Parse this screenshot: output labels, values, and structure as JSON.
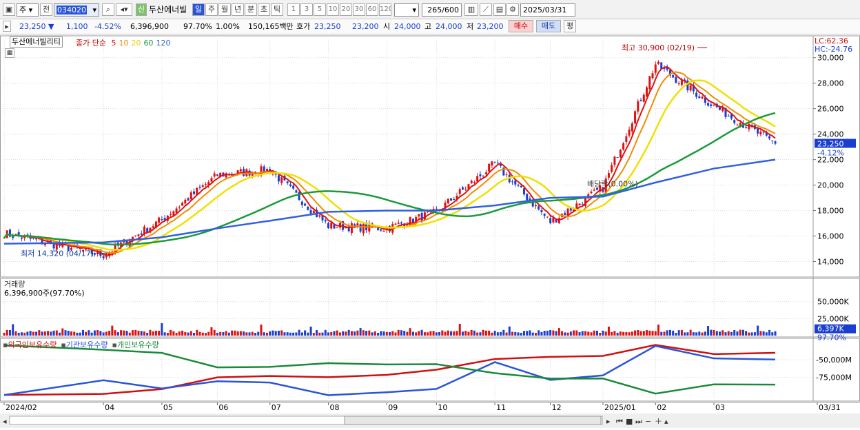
{
  "toolbar": {
    "mode": "주",
    "prev": "전",
    "code": "034020",
    "shin": "신",
    "stock_name": "두산에너빌",
    "periods": [
      "일",
      "주",
      "월",
      "년",
      "분",
      "초",
      "틱"
    ],
    "active_period": "일",
    "nums": [
      "1",
      "3",
      "5",
      "10",
      "20",
      "30",
      "60",
      "120"
    ],
    "count": "265",
    "count_total": "/600",
    "date": "2025/03/31"
  },
  "quote": {
    "price": "23,250",
    "arrow": "▼",
    "change": "1,100",
    "change_pct": "-4.52%",
    "volume": "6,396,900",
    "vol_ratio": "97.70%",
    "rate": "1.00%",
    "amount": "150,165백만",
    "ho_label": "호가",
    "ask": "23,250",
    "bid": "23,200",
    "open_label": "시",
    "open": "24,000",
    "high_label": "고",
    "high": "24,000",
    "low_label": "저",
    "low": "23,200",
    "buy_btn": "매수",
    "sell_btn": "매도",
    "eval_btn": "평"
  },
  "price_panel": {
    "name_tag": "두산에너빌리티",
    "ma_label": "종가 단순",
    "ma_periods": [
      {
        "period": "5",
        "color": "#e01010"
      },
      {
        "period": "10",
        "color": "#f08c00"
      },
      {
        "period": "20",
        "color": "#e8d000"
      },
      {
        "period": "60",
        "color": "#1a9a3a"
      },
      {
        "period": "120",
        "color": "#3060e0"
      }
    ],
    "lc": "LC:62.36",
    "hc": "HC:-24.76",
    "high_annot": "최고 30,900 (02/19)",
    "low_annot": "최저 14,320 (04/17)",
    "dividend_annot": "배당락(0.00%)",
    "price_tag": "23,250",
    "price_tag_pct": "-4.12%"
  },
  "volume_panel": {
    "title": "거래량",
    "value": "6,396,900주(97.70%)",
    "tag": "6,397K",
    "tag_pct": "97.70%"
  },
  "holders_panel": {
    "series": [
      {
        "name": "외국인보유수량",
        "color": "#d01010"
      },
      {
        "name": "기관보유수량",
        "color": "#2a55d8"
      },
      {
        "name": "개인보유수량",
        "color": "#1a8a3a"
      }
    ]
  },
  "x_axis": [
    "2024/02",
    "04",
    "05",
    "06",
    "07",
    "08",
    "09",
    "10",
    "11",
    "12",
    "2025/01",
    "02",
    "03",
    "03/31"
  ],
  "colors": {
    "up": "#e01010",
    "down": "#1a3fd0",
    "ma5": "#e01010",
    "ma10": "#f08c00",
    "ma20": "#f0e000",
    "ma60": "#1a9a3a",
    "ma120": "#3060e0"
  },
  "chart_data": [
    {
      "type": "line",
      "title": "두산에너빌리티 종가",
      "x": [
        "2024/02",
        "04",
        "05",
        "06",
        "07",
        "08",
        "09",
        "10",
        "11",
        "12",
        "2025/01",
        "02",
        "03",
        "03/31"
      ],
      "series": [
        {
          "name": "종가",
          "values": [
            16200,
            14500,
            17300,
            20800,
            21200,
            16800,
            16600,
            17900,
            21700,
            17100,
            19800,
            29500,
            26200,
            23250
          ]
        },
        {
          "name": "120",
          "values": [
            15400,
            15500,
            15900,
            16600,
            17200,
            17900,
            18000,
            18000,
            18400,
            19000,
            19100,
            20200,
            21300,
            22000
          ]
        }
      ],
      "ylim": [
        13000,
        31500
      ],
      "y_ticks": [
        "14,000",
        "16,000",
        "18,000",
        "20,000",
        "22,000",
        "24,000",
        "26,000",
        "28,000",
        "30,000"
      ]
    },
    {
      "type": "bar",
      "title": "거래량",
      "y_ticks": [
        "25,000K",
        "50,000K"
      ],
      "ylim": [
        0,
        70000
      ]
    },
    {
      "type": "line",
      "title": "보유수량",
      "y_ticks": [
        "-50,000M",
        "-75,000M"
      ]
    }
  ]
}
